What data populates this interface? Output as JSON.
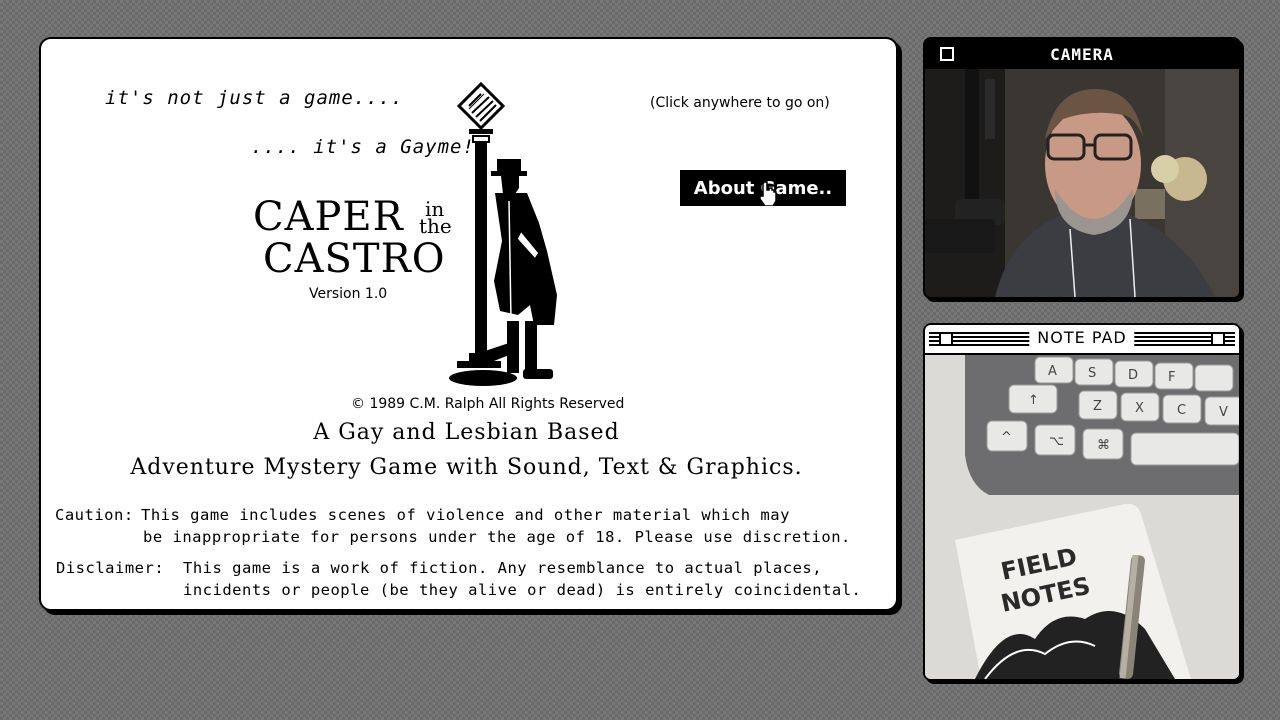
{
  "game": {
    "tagline_1": "it's not just a game....",
    "tagline_2": ".... it's a Gayme!",
    "hint": "(Click anywhere to go on)",
    "about_button": "About Game..",
    "title_caper": "CAPER",
    "title_in": "in",
    "title_the": "the",
    "title_castro": "CASTRO",
    "version": "Version 1.0",
    "copyright": "© 1989 C.M. Ralph  All Rights Reserved",
    "headline_1": "A Gay and Lesbian Based",
    "headline_2": "Adventure Mystery Game with Sound, Text & Graphics.",
    "caution_label": "Caution:",
    "caution_line_1": "This game includes scenes of violence and other material which may",
    "caution_line_2": "be inappropriate for persons under the age of 18. Please use discretion.",
    "disclaimer_label": "Disclaimer:",
    "disclaimer_line_1": "This game is a work of fiction. Any resemblance to actual places,",
    "disclaimer_line_2": "incidents or people (be they alive or dead) is entirely coincidental."
  },
  "camera": {
    "title": "CAMERA"
  },
  "notepad": {
    "title": "NOTE PAD",
    "notebook_text_1": "FIELD",
    "notebook_text_2": "NOTES"
  },
  "keycaps": [
    "A",
    "S",
    "D",
    "F",
    "↑",
    "Z",
    "X",
    "C",
    "V",
    "^",
    "⌥",
    "⌘"
  ]
}
